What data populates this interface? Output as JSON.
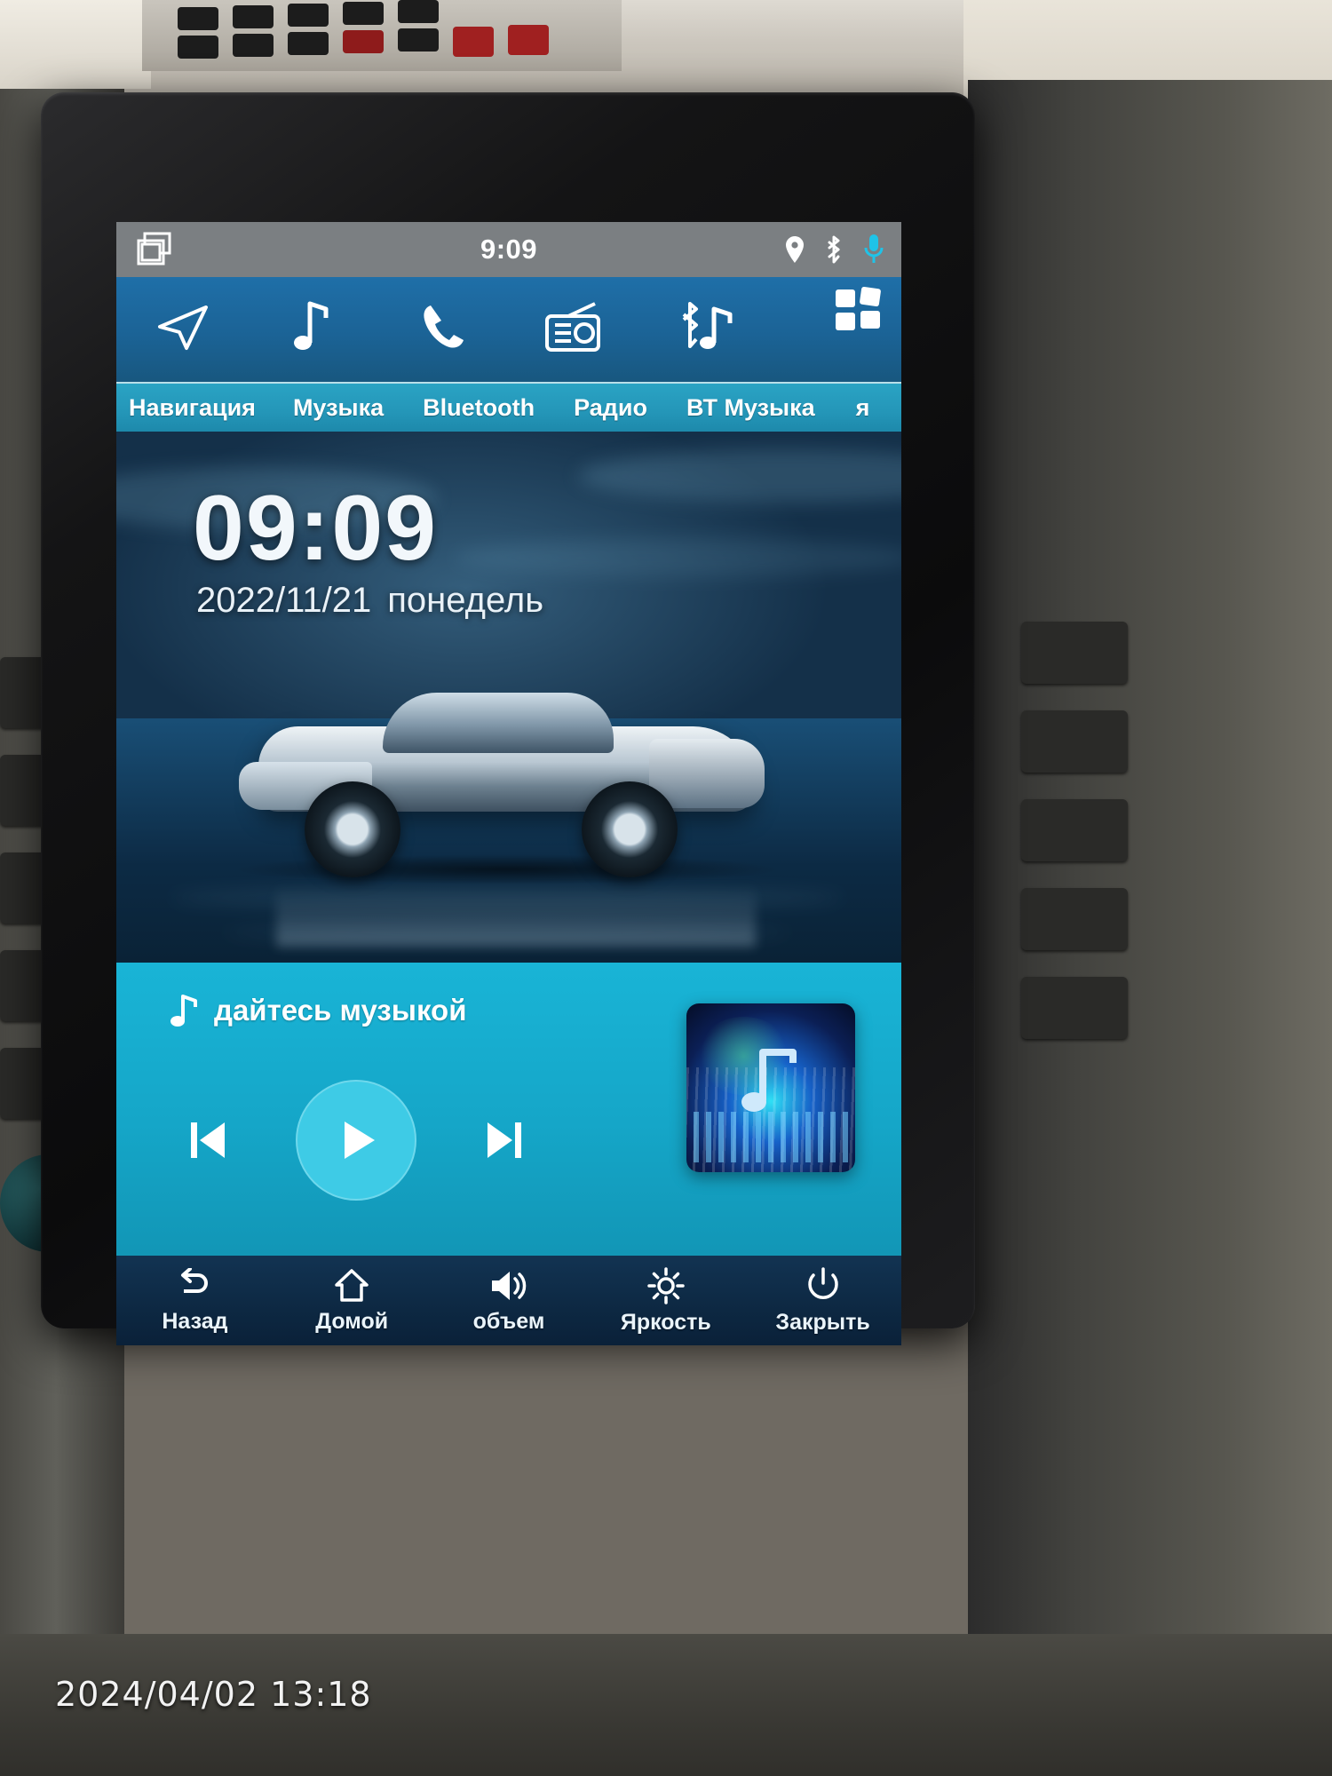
{
  "status_bar": {
    "time": "9:09",
    "recent_apps_icon": "recent-apps-icon",
    "icons": [
      "location-pin-icon",
      "bluetooth-icon",
      "microphone-icon"
    ]
  },
  "app_bar": {
    "apps": [
      {
        "icon": "navigation-arrow-icon",
        "label": "Навигация"
      },
      {
        "icon": "music-note-icon",
        "label": "Музыка"
      },
      {
        "icon": "phone-handset-icon",
        "label": "Bluetooth"
      },
      {
        "icon": "radio-icon",
        "label": "Радио"
      },
      {
        "icon": "bluetooth-music-icon",
        "label": "ВТ Музыка"
      },
      {
        "icon": "apps-grid-icon",
        "label": "я"
      }
    ],
    "grid_button_icon": "apps-grid-icon"
  },
  "wallpaper": {
    "clock": "09:09",
    "date": "2022/11/21",
    "day_of_week": "понедель",
    "image_subject": "silver sports car on wet blue surface"
  },
  "player": {
    "note_icon": "music-note-icon",
    "title": "дайтесь музыкой",
    "prev_icon": "skip-previous-icon",
    "play_icon": "play-icon",
    "next_icon": "skip-next-icon",
    "album_art_icon": "album-art-music-note"
  },
  "nav_bar": {
    "items": [
      {
        "icon": "back-arrow-icon",
        "label": "Назад"
      },
      {
        "icon": "home-icon",
        "label": "Домой"
      },
      {
        "icon": "volume-icon",
        "label": "объем"
      },
      {
        "icon": "brightness-icon",
        "label": "Яркость"
      },
      {
        "icon": "power-icon",
        "label": "Закрыть"
      }
    ]
  },
  "camera": {
    "timestamp": "2024/04/02 13:18"
  },
  "colors": {
    "status_bar": "#7b7f82",
    "app_bar": "#1b6396",
    "tab_bar": "#2496b8",
    "player": "#15a6c8",
    "nav_bar": "#0d2842",
    "accent": "#3ecbe6"
  }
}
